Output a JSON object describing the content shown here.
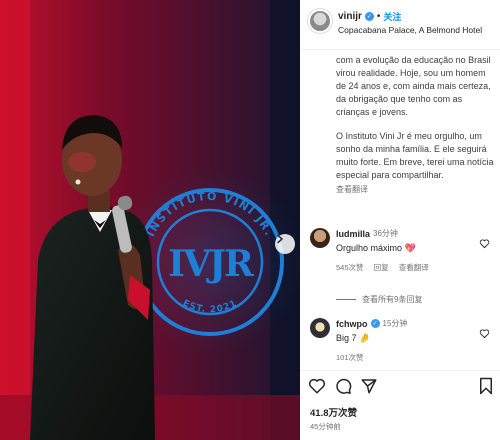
{
  "post": {
    "author": "vinijr",
    "follow_label": "关注",
    "dot": "•",
    "location": "Copacabana Palace, A Belmond Hotel",
    "caption_paragraphs": [
      "com a evolução da educação no Brasil virou realidade. Hoje, sou um homem de 24 anos e, com ainda mais certeza, da obrigação que tenho com as crianças e jovens.",
      "O Instituto Vini Jr é meu orgulho, um sonho da minha família. E ele seguirá muito forte. Em breve, terei uma notícia especial para compartilhar."
    ],
    "see_translation": "查看翻译",
    "likes": "41.8万次赞",
    "time_ago": "45分钟前"
  },
  "photo": {
    "logo_top_text": "INSTITUTO VINI JR.",
    "logo_bottom_text": "EST. 2021",
    "logo_monogram": "IVJR"
  },
  "comments": [
    {
      "username": "ludmilla",
      "time": "36分钟",
      "text": "Orgulho máximo 💖",
      "likes": "545次赞",
      "reply": "回复",
      "translate": "查看翻译"
    },
    {
      "username": "fchwpo",
      "time": "15分钟",
      "text": "Big 7 🤌",
      "likes": "101次赞"
    }
  ],
  "view_replies": "查看所有9条回复",
  "colors": {
    "accent": "#0095f6",
    "verified": "#3897f0",
    "muted": "#737373",
    "stage_red": "#c8102e",
    "logo_blue": "#1f7fd6"
  }
}
